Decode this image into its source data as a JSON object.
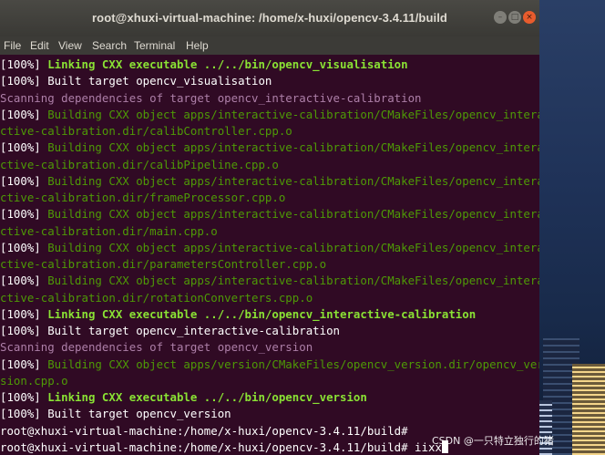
{
  "window": {
    "title": "root@xhuxi-virtual-machine: /home/x-huxi/opencv-3.4.11/build",
    "min_glyph": "–",
    "max_glyph": "□",
    "close_glyph": "×"
  },
  "menu": [
    "File",
    "Edit",
    "View",
    "Search",
    "Terminal",
    "Help"
  ],
  "lines": [
    [
      {
        "t": "[100%] ",
        "c": "white"
      },
      {
        "t": "Linking CXX executable ../../bin/opencv_visualisation",
        "c": "greenb"
      }
    ],
    [
      {
        "t": "[100%] Built target opencv_visualisation",
        "c": "white"
      }
    ],
    [
      {
        "t": "Scanning dependencies of target opencv_interactive-calibration",
        "c": "magenta"
      }
    ],
    [
      {
        "t": "[100%] ",
        "c": "white"
      },
      {
        "t": "Building CXX object apps/interactive-calibration/CMakeFiles/opencv_intera",
        "c": "green"
      }
    ],
    [
      {
        "t": "ctive-calibration.dir/calibController.cpp.o",
        "c": "green"
      }
    ],
    [
      {
        "t": "[100%] ",
        "c": "white"
      },
      {
        "t": "Building CXX object apps/interactive-calibration/CMakeFiles/opencv_intera",
        "c": "green"
      }
    ],
    [
      {
        "t": "ctive-calibration.dir/calibPipeline.cpp.o",
        "c": "green"
      }
    ],
    [
      {
        "t": "[100%] ",
        "c": "white"
      },
      {
        "t": "Building CXX object apps/interactive-calibration/CMakeFiles/opencv_intera",
        "c": "green"
      }
    ],
    [
      {
        "t": "ctive-calibration.dir/frameProcessor.cpp.o",
        "c": "green"
      }
    ],
    [
      {
        "t": "[100%] ",
        "c": "white"
      },
      {
        "t": "Building CXX object apps/interactive-calibration/CMakeFiles/opencv_intera",
        "c": "green"
      }
    ],
    [
      {
        "t": "ctive-calibration.dir/main.cpp.o",
        "c": "green"
      }
    ],
    [
      {
        "t": "[100%] ",
        "c": "white"
      },
      {
        "t": "Building CXX object apps/interactive-calibration/CMakeFiles/opencv_intera",
        "c": "green"
      }
    ],
    [
      {
        "t": "ctive-calibration.dir/parametersController.cpp.o",
        "c": "green"
      }
    ],
    [
      {
        "t": "[100%] ",
        "c": "white"
      },
      {
        "t": "Building CXX object apps/interactive-calibration/CMakeFiles/opencv_intera",
        "c": "green"
      }
    ],
    [
      {
        "t": "ctive-calibration.dir/rotationConverters.cpp.o",
        "c": "green"
      }
    ],
    [
      {
        "t": "[100%] ",
        "c": "white"
      },
      {
        "t": "Linking CXX executable ../../bin/opencv_interactive-calibration",
        "c": "greenb"
      }
    ],
    [
      {
        "t": "[100%] Built target opencv_interactive-calibration",
        "c": "white"
      }
    ],
    [
      {
        "t": "Scanning dependencies of target opencv_version",
        "c": "magenta"
      }
    ],
    [
      {
        "t": "[100%] ",
        "c": "white"
      },
      {
        "t": "Building CXX object apps/version/CMakeFiles/opencv_version.dir/opencv_ver",
        "c": "green"
      }
    ],
    [
      {
        "t": "sion.cpp.o",
        "c": "green"
      }
    ],
    [
      {
        "t": "[100%] ",
        "c": "white"
      },
      {
        "t": "Linking CXX executable ../../bin/opencv_version",
        "c": "greenb"
      }
    ],
    [
      {
        "t": "[100%] Built target opencv_version",
        "c": "white"
      }
    ],
    [
      {
        "t": "root@xhuxi-virtual-machine:/home/x-huxi/opencv-3.4.11/build#",
        "c": "white"
      }
    ],
    [
      {
        "t": "root@xhuxi-virtual-machine:/home/x-huxi/opencv-3.4.11/build# iixx",
        "c": "white"
      }
    ]
  ],
  "watermark": "CSDN @一只特立独行的猪",
  "colors": {
    "terminal_bg": "#300a24",
    "green": "#4e9a06",
    "green_bold": "#8ae234",
    "magenta": "#ad7fa8",
    "close_button": "#e85c2d"
  }
}
